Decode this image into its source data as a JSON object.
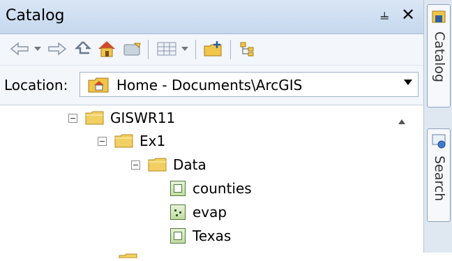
{
  "panel": {
    "title": "Catalog"
  },
  "location": {
    "label": "Location:",
    "value": "Home - Documents\\ArcGIS"
  },
  "tree": {
    "items": [
      {
        "label": "GISWR11",
        "type": "folder",
        "expanded": true
      },
      {
        "label": "Ex1",
        "type": "folder",
        "expanded": true
      },
      {
        "label": "Data",
        "type": "folder",
        "expanded": true
      },
      {
        "label": "counties",
        "type": "raster"
      },
      {
        "label": "evap",
        "type": "raster"
      },
      {
        "label": "Texas",
        "type": "raster"
      }
    ]
  },
  "side_tabs": [
    {
      "label": "Catalog"
    },
    {
      "label": "Search"
    }
  ],
  "colors": {
    "title_bg": "#c6d8ee",
    "folder": "#e8c04a",
    "raster_green": "#4e7a3a"
  }
}
